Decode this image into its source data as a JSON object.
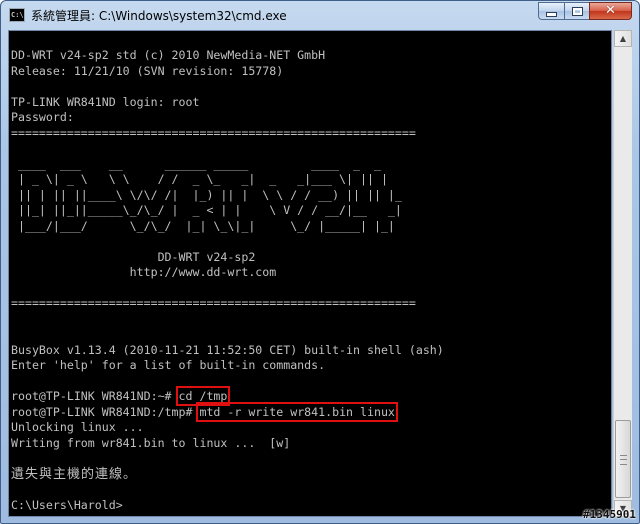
{
  "window": {
    "icon_label": "C:\\",
    "title": "系統管理員: C:\\Windows\\system32\\cmd.exe",
    "minimize_icon": "minimize-icon",
    "maximize_icon": "maximize-icon",
    "close_glyph": "✕"
  },
  "console": {
    "lines": [
      "DD-WRT v24-sp2 std (c) 2010 NewMedia-NET GmbH",
      "Release: 11/21/10 (SVN revision: 15778)",
      "",
      "TP-LINK WR841ND login: root",
      "Password:",
      "==========================================================",
      "",
      " ____  ___    __      ______ _____         ____  _  _ ",
      " | _ \\| _ \\   \\ \\    / /  _ \\_   _|  _   _|___ \\| || |",
      " || | || ||____\\ \\/\\/ /|  |_) || |  \\ \\ / / __) || || |_",
      " ||_| ||_||_____\\_/\\_/ |  _ < | |    \\ V / / __/|__   _|",
      " |___/|___/      \\_/\\_/  |_| \\_\\|_|     \\_/ |_____| |_|",
      "",
      "                     DD-WRT v24-sp2",
      "                 http://www.dd-wrt.com",
      "",
      "==========================================================",
      "",
      "",
      "BusyBox v1.13.4 (2010-11-21 11:52:50 CET) built-in shell (ash)",
      "Enter 'help' for a list of built-in commands.",
      "",
      "root@TP-LINK WR841ND:~# cd /tmp",
      "root@TP-LINK WR841ND:/tmp# mtd -r write wr841.bin linux",
      "Unlocking linux ...",
      "Writing from wr841.bin to linux ...  [w]"
    ],
    "msg": "遺失與主機的連線。",
    "blank": "",
    "prompt": "C:\\Users\\Harold>",
    "cmd1_prompt": "root@TP-LINK WR841ND:~# ",
    "cmd1": "cd /tmp",
    "cmd2_prompt": "root@TP-LINK WR841ND:/tmp# ",
    "cmd2": "mtd -r write wr841.bin linux"
  },
  "scrollbar": {
    "up_glyph": "▲",
    "down_glyph": "▼"
  },
  "watermark": "#1345901",
  "colors": {
    "console_bg": "#000000",
    "console_fg": "#c0c0c0",
    "highlight": "#e01010"
  }
}
